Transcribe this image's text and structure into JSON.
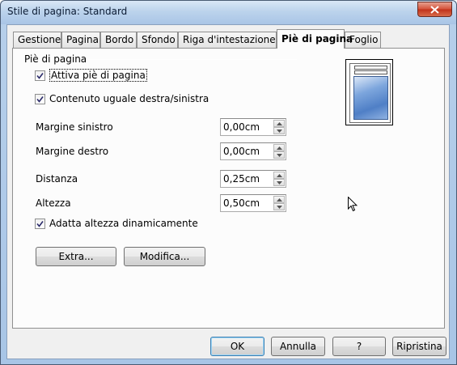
{
  "window": {
    "title": "Stile di pagina: Standard"
  },
  "tabs": [
    {
      "label": "Gestione"
    },
    {
      "label": "Pagina"
    },
    {
      "label": "Bordo"
    },
    {
      "label": "Sfondo"
    },
    {
      "label": "Riga d'intestazione"
    },
    {
      "label": "Piè di pagina",
      "active": true
    },
    {
      "label": "Foglio"
    }
  ],
  "footer": {
    "group_label": "Piè di pagina",
    "enable_footer": {
      "label": "Attiva piè di pagina",
      "checked": true
    },
    "same_content": {
      "label": "Contenuto uguale destra/sinistra",
      "checked": true
    },
    "left_margin": {
      "label": "Margine sinistro",
      "value": "0,00cm"
    },
    "right_margin": {
      "label": "Margine destro",
      "value": "0,00cm"
    },
    "spacing": {
      "label": "Distanza",
      "value": "0,25cm"
    },
    "height": {
      "label": "Altezza",
      "value": "0,50cm"
    },
    "autofit": {
      "label": "Adatta altezza dinamicamente",
      "checked": true
    },
    "more_button": "Extra...",
    "edit_button": "Modifica..."
  },
  "buttons": {
    "ok": "OK",
    "cancel": "Annulla",
    "help": "?",
    "reset": "Ripristina"
  },
  "icons": {
    "close": "close-icon",
    "check": "checkmark-icon",
    "spin_up": "triangle-up-icon",
    "spin_down": "triangle-down-icon",
    "cursor": "mouse-pointer-icon"
  }
}
